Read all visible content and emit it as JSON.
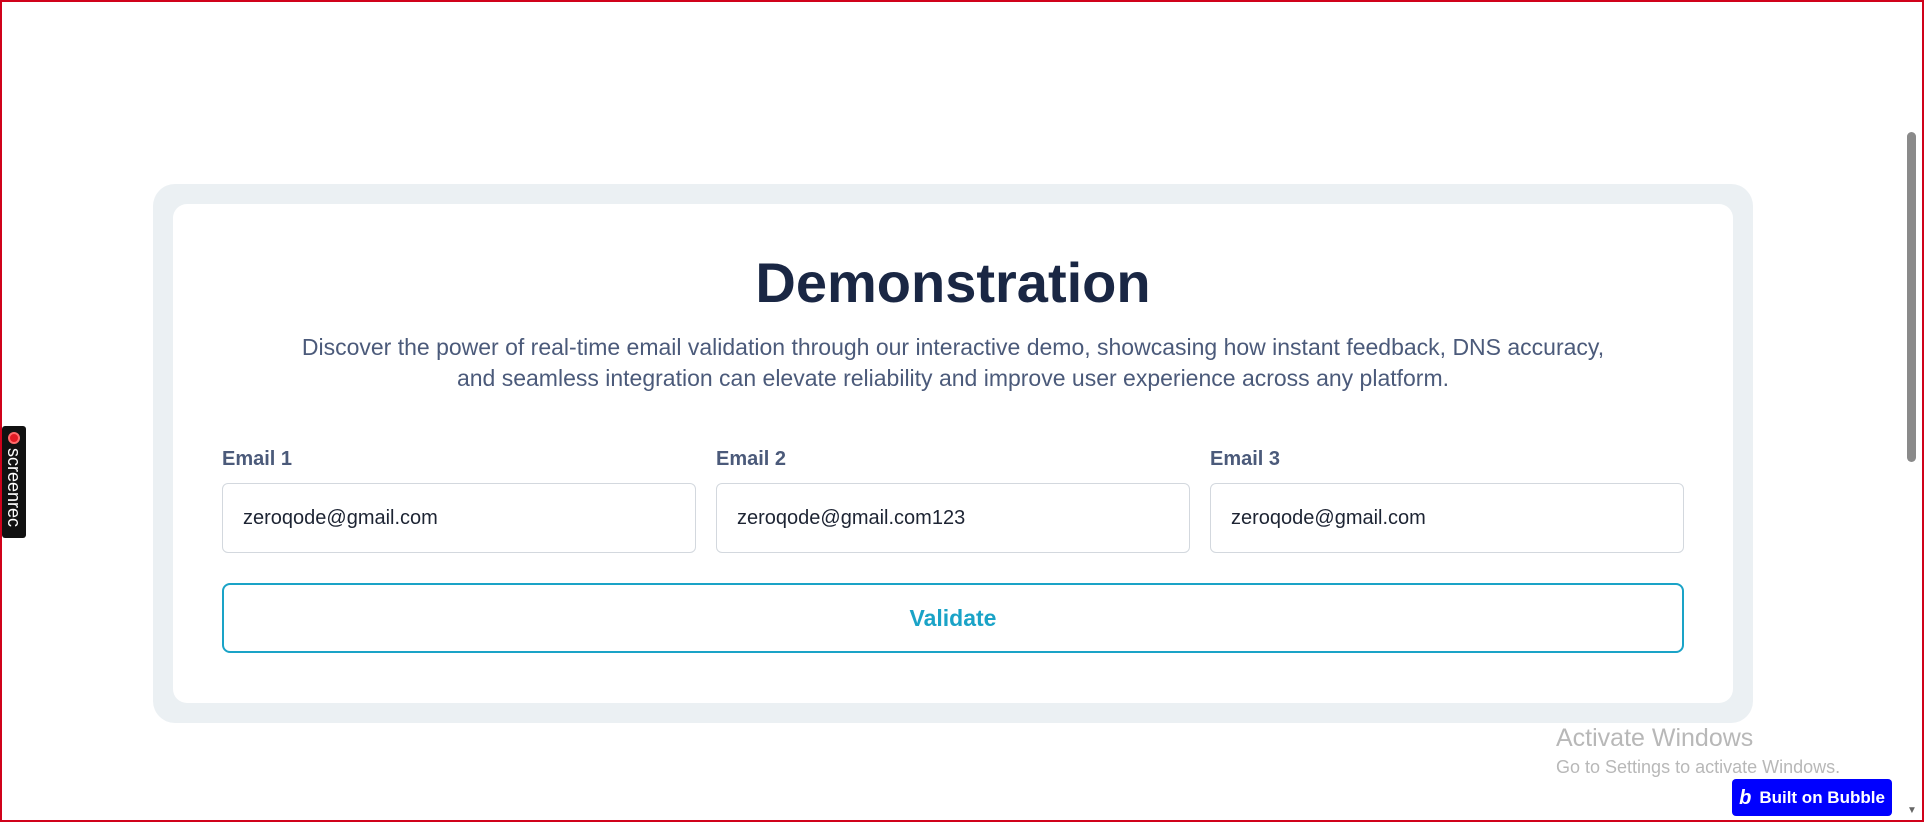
{
  "demo": {
    "title": "Demonstration",
    "description": "Discover the power of real-time email validation through our interactive demo, showcasing how instant feedback, DNS accuracy, and seamless integration can elevate reliability and improve user experience across any platform.",
    "fields": [
      {
        "label": "Email 1",
        "value": "zeroqode@gmail.com"
      },
      {
        "label": "Email 2",
        "value": "zeroqode@gmail.com123"
      },
      {
        "label": "Email 3",
        "value": "zeroqode@gmail.com"
      }
    ],
    "button_label": "Validate"
  },
  "overlays": {
    "screenrec_label": "screenrec",
    "activate_title": "Activate Windows",
    "activate_subtitle": "Go to Settings to activate Windows.",
    "bubble_badge": "Built on Bubble",
    "bubble_icon": "b"
  },
  "icons": {
    "record": "record-dot-icon",
    "bubble": "bubble-logo-icon"
  },
  "colors": {
    "accent": "#1aa3c7",
    "heading": "#1a2744",
    "body_text": "#4b5a7a",
    "card_outer": "#ebf0f3",
    "badge_bg": "#0000ff",
    "frame_border": "#d0021b"
  }
}
